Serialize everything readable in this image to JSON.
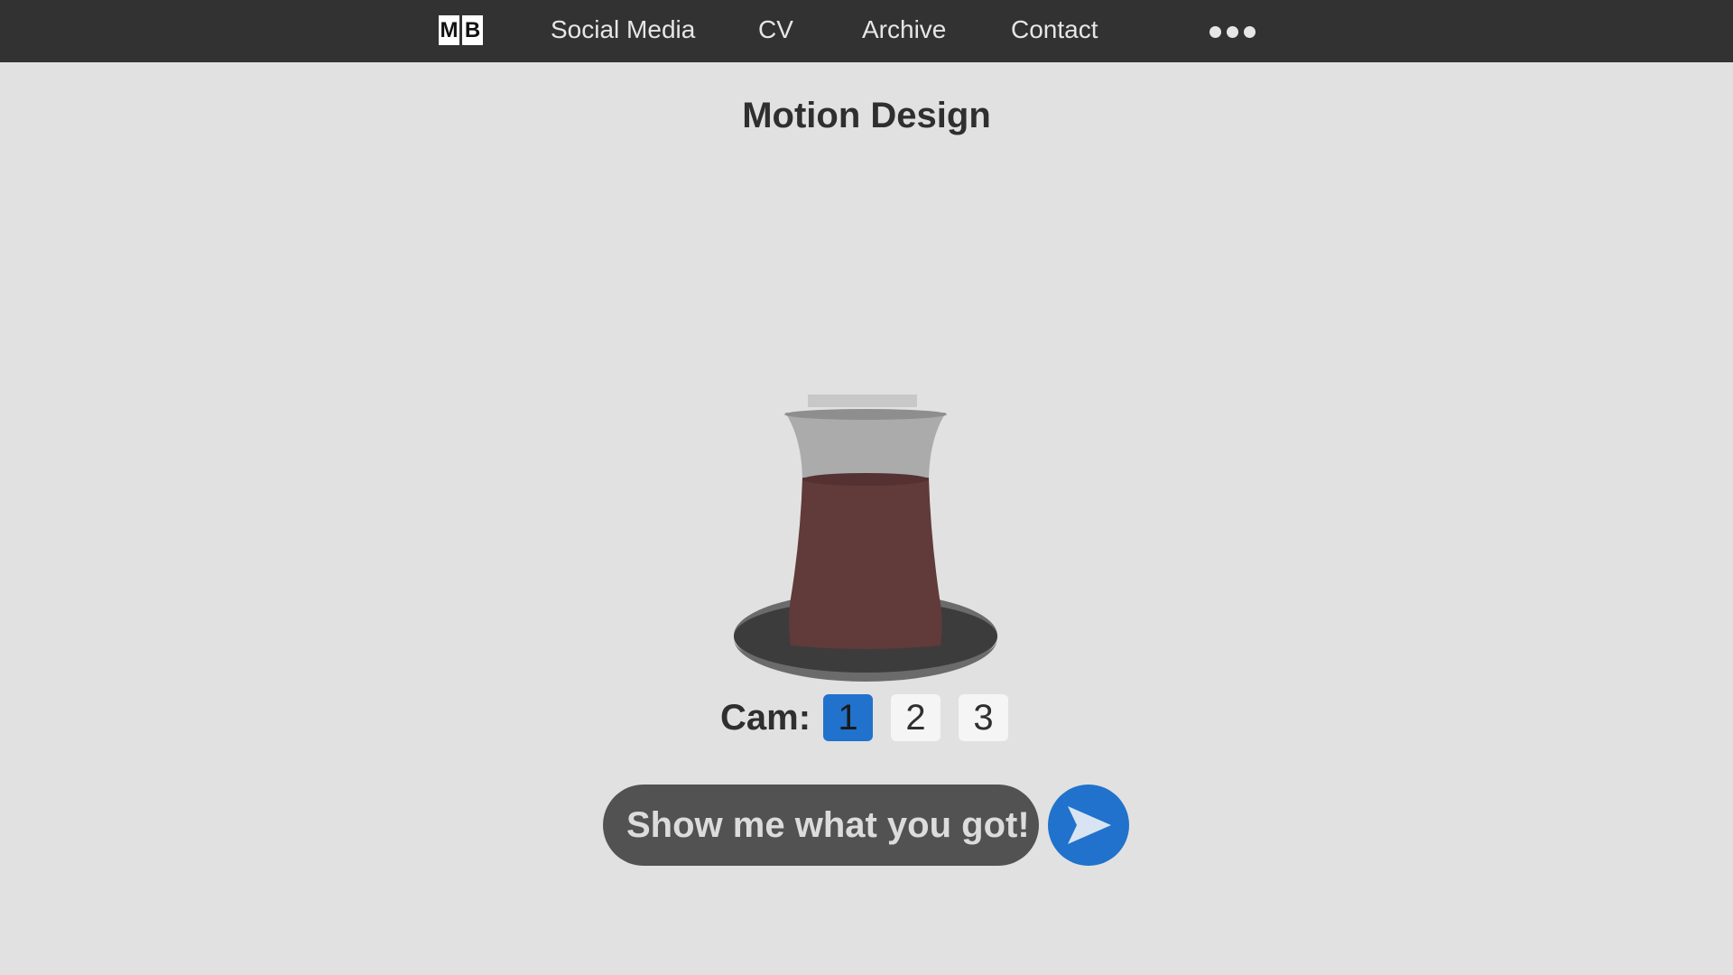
{
  "nav": {
    "logo_letters": [
      "M",
      "B"
    ],
    "links": [
      "Social Media",
      "CV",
      "Archive",
      "Contact"
    ],
    "more_icon": "more-dots-icon"
  },
  "main": {
    "title": "Motion Design",
    "illustration": "tea-glass-on-saucer",
    "cam": {
      "label": "Cam:",
      "options": [
        "1",
        "2",
        "3"
      ],
      "selected": "1"
    },
    "chat": {
      "value": "Show me what you got!",
      "send_icon": "send-arrow-icon"
    }
  },
  "colors": {
    "navbar": "#323232",
    "background": "#e1e1e1",
    "accent": "#2172cc",
    "input": "#525252",
    "tea": "#613a3a"
  }
}
